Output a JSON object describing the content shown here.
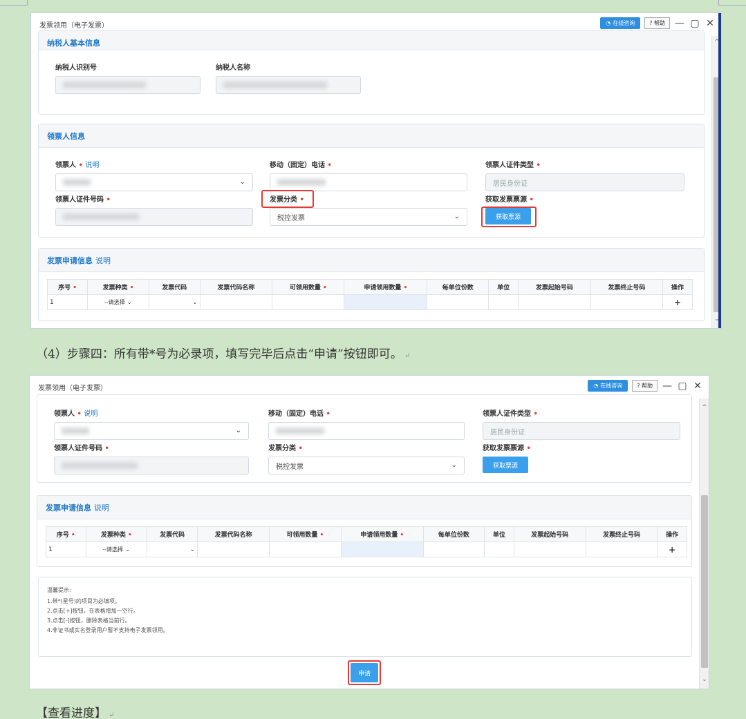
{
  "window": {
    "title": "发票领用（电子发票）",
    "online_button": "在线咨询",
    "help_button": "? 帮助",
    "minimize": "—",
    "restore": "▢",
    "close": "✕"
  },
  "shot1": {
    "taxpayer_section": {
      "title": "纳税人基本信息",
      "id_label": "纳税人识别号",
      "name_label": "纳税人名称"
    },
    "receiver_section": {
      "title": "领票人信息",
      "receiver_label": "领票人",
      "receiver_note": "说明",
      "phone_label": "移动（固定）电话",
      "id_type_label": "领票人证件类型",
      "id_type_value": "居民身份证",
      "id_no_label": "领票人证件号码",
      "category_label": "发票分类",
      "category_value": "税控发票",
      "source_label": "获取发票票源",
      "source_button": "获取票源"
    },
    "apply_section": {
      "title": "发票申请信息",
      "note": "说明",
      "columns": [
        "序号",
        "发票种类",
        "发票代码",
        "发票代码名称",
        "可领用数量",
        "申请领用数量",
        "每单位份数",
        "单位",
        "发票起始号码",
        "发票终止号码",
        "操作"
      ],
      "required_cols": [
        0,
        1,
        4,
        5
      ],
      "row": {
        "no": "1",
        "type": "--请选择",
        "add": "+"
      }
    }
  },
  "step_caption": "（4）步骤四：所有带*号为必录项，填写完毕后点击“申请”按钮即可。",
  "shot2": {
    "tips": {
      "title": "温馨提示:",
      "items": [
        "1.带*(星号)的项目为必填项。",
        "2.点击[+]按钮，在表格增加一空行。",
        "3.点击[-]按钮，删除表格当前行。",
        "4.非证书或实名登录用户暂不支持电子发票领用。"
      ]
    },
    "apply_button": "申请"
  },
  "next_heading": "【查看进度】"
}
